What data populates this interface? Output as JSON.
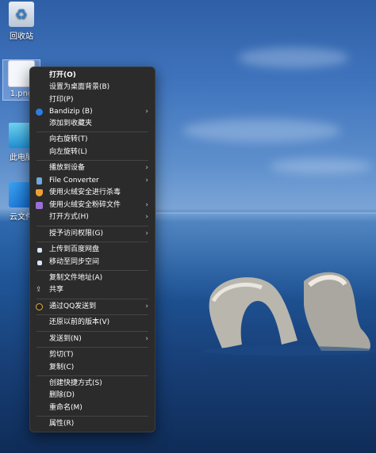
{
  "desktop": {
    "icons": [
      {
        "label": "回收站"
      },
      {
        "label": "1.png"
      },
      {
        "label": "此电脑"
      },
      {
        "label": "云文件"
      }
    ]
  },
  "menu": {
    "open": "打开(O)",
    "set_wallpaper": "设置为桌面背景(B)",
    "print": "打印(P)",
    "bandizip": "Bandizip (B)",
    "add_favorite": "添加到收藏夹",
    "rotate_right": "向右旋转(T)",
    "rotate_left": "向左旋转(L)",
    "cast": "播放到设备",
    "file_converter": "File Converter",
    "hr_scan": "使用火绒安全进行杀毒",
    "hr_shred": "使用火绒安全粉碎文件",
    "open_with": "打开方式(H)",
    "grant_access": "授予访问权限(G)",
    "baidu_upload": "上传到百度网盘",
    "sync_space": "移动至同步空间",
    "copy_path": "复制文件地址(A)",
    "share": "共享",
    "qq_send": "通过QQ发送到",
    "restore": "还原以前的版本(V)",
    "send_to": "发送到(N)",
    "cut": "剪切(T)",
    "copy": "复制(C)",
    "create_shortcut": "创建快捷方式(S)",
    "delete": "删除(D)",
    "rename": "重命名(M)",
    "properties": "属性(R)"
  },
  "icons": {
    "bandizip": "bandizip-icon",
    "file_converter": "file-converter-icon",
    "hr_scan": "huorong-shield-icon",
    "hr_shred": "huorong-shred-icon",
    "baidu": "baidu-netdisk-icon",
    "sync": "sync-space-icon",
    "share": "share-icon",
    "qq": "qq-penguin-icon"
  },
  "colors": {
    "menu_bg": "#2b2b2b",
    "menu_text": "#ffffff",
    "separator": "#454545"
  }
}
